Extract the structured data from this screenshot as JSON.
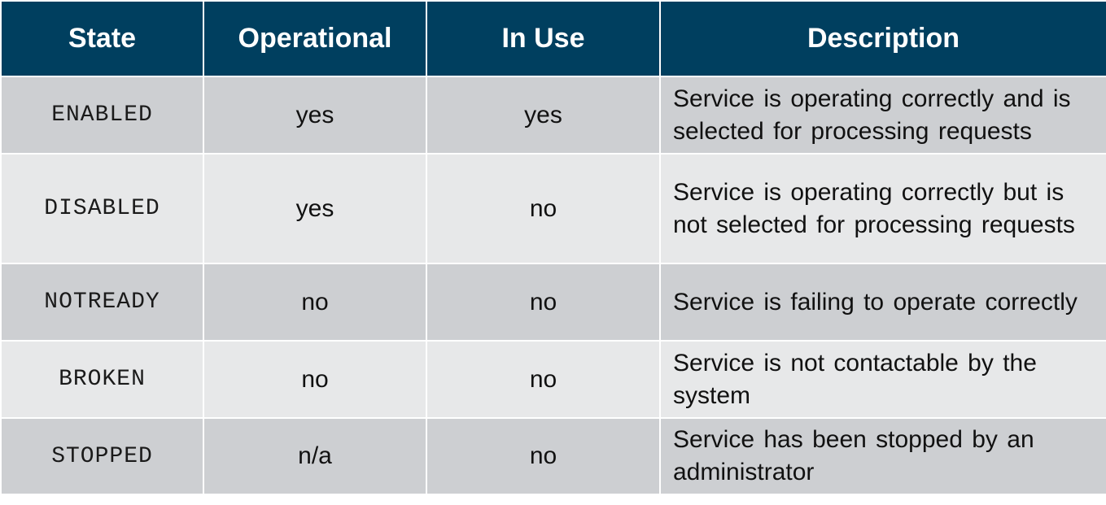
{
  "table": {
    "headers": [
      "State",
      "Operational",
      "In Use",
      "Description"
    ],
    "rows": [
      {
        "state": "ENABLED",
        "operational": "yes",
        "in_use": "yes",
        "description": "Service is operating correctly and is selected for processing requests"
      },
      {
        "state": "DISABLED",
        "operational": "yes",
        "in_use": "no",
        "description": "Service is operating correctly but is not selected for processing requests"
      },
      {
        "state": "NOTREADY",
        "operational": "no",
        "in_use": "no",
        "description": "Service is failing to operate correctly"
      },
      {
        "state": "BROKEN",
        "operational": "no",
        "in_use": "no",
        "description": "Service is not contactable by the system"
      },
      {
        "state": "STOPPED",
        "operational": "n/a",
        "in_use": "no",
        "description": "Service has been stopped by an administrator"
      }
    ]
  },
  "colors": {
    "header_bg": "#003f5f",
    "header_text": "#ffffff",
    "row_odd_bg": "#cdcfd2",
    "row_even_bg": "#e7e8e9"
  }
}
